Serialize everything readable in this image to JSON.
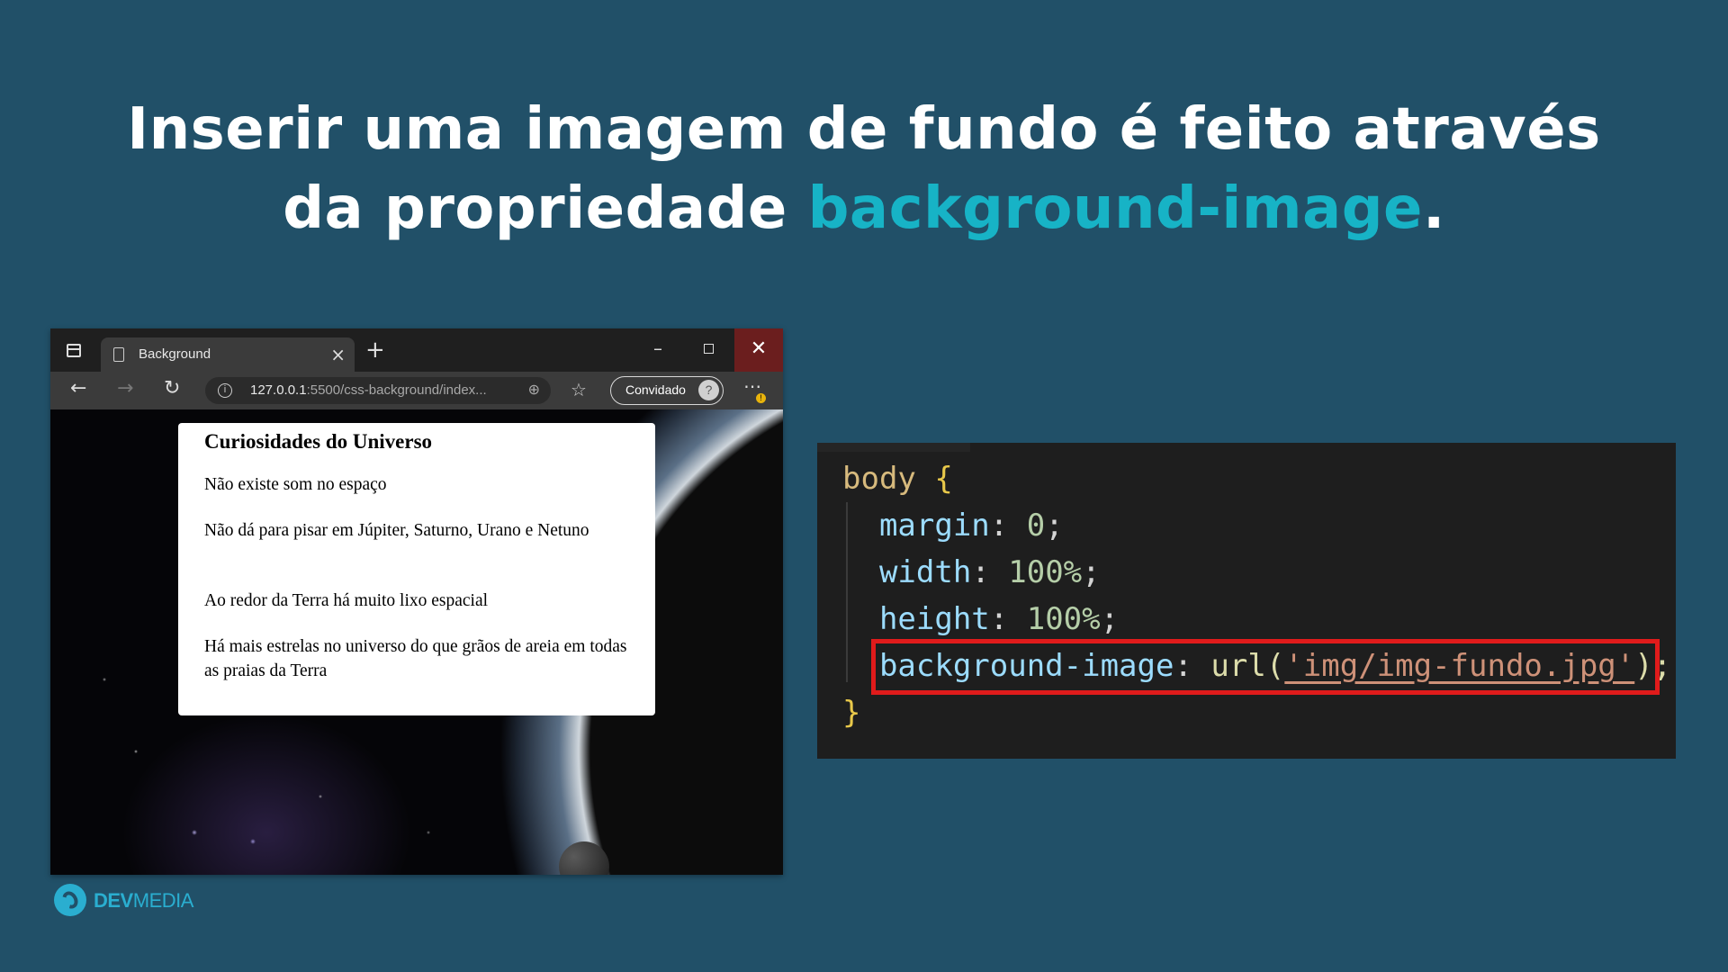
{
  "headline": {
    "line1": "Inserir uma imagem de fundo é feito através",
    "line2_prefix": "da propriedade ",
    "line2_accent": "background-image",
    "line2_suffix": "."
  },
  "colors": {
    "background": "#215068",
    "accent": "#17b3c6",
    "highlight_box": "#e01b1b"
  },
  "browser": {
    "tab_title": "Background",
    "tab_close": "×",
    "new_tab": "+",
    "url_host": "127.0.0.1",
    "url_rest": ":5500/css-background/index...",
    "profile_label": "Convidado",
    "icons": [
      "tabs-icon",
      "page-icon",
      "back-arrow-icon",
      "forward-arrow-icon",
      "reload-icon",
      "info-icon",
      "zoom-icon",
      "favorites-icon",
      "avatar-icon",
      "more-icon",
      "minimize-icon",
      "maximize-icon",
      "close-icon"
    ]
  },
  "page_card": {
    "title": "Curiosidades do Universo",
    "items": [
      "Não existe som no espaço",
      "Não dá para pisar em Júpiter, Saturno, Urano e Netuno",
      "Ao redor da Terra há muito lixo espacial",
      "Há mais estrelas no universo do que grãos de areia em todas as praias da Terra"
    ]
  },
  "code": {
    "selector": "body",
    "open_brace": "{",
    "close_brace": "}",
    "lines": [
      {
        "prop": "margin",
        "value": "0"
      },
      {
        "prop": "width",
        "value": "100%"
      },
      {
        "prop": "height",
        "value": "100%"
      }
    ],
    "highlight": {
      "prop": "background-image",
      "fn": "url(",
      "arg": "'img/img-fundo.jpg'",
      "close": ");"
    }
  },
  "logo": {
    "bold": "DEV",
    "regular": "MEDIA"
  }
}
